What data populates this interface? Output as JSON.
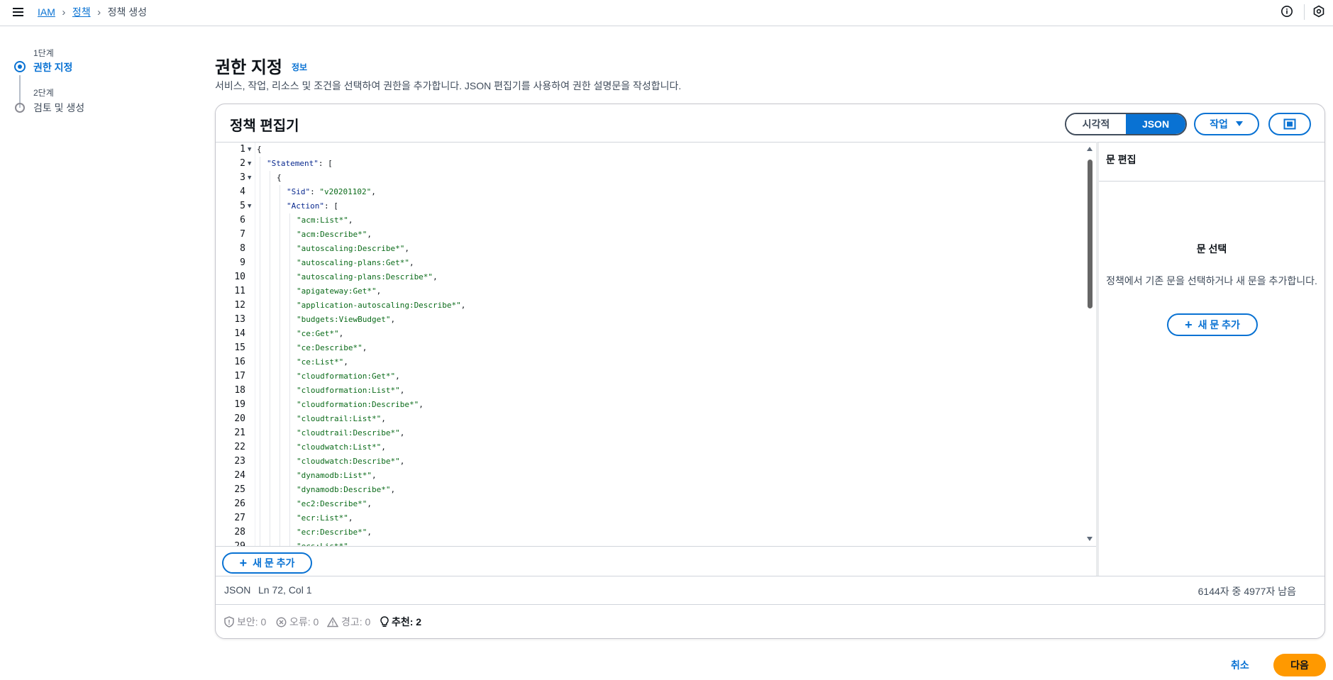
{
  "breadcrumb": {
    "iam": "IAM",
    "policies": "정책",
    "current": "정책 생성"
  },
  "steps": [
    {
      "number": "1단계",
      "title": "권한 지정"
    },
    {
      "number": "2단계",
      "title": "검토 및 생성"
    }
  ],
  "header": {
    "title": "권한 지정",
    "info": "정보",
    "description": "서비스, 작업, 리소스 및 조건을 선택하여 권한을 추가합니다. JSON 편집기를 사용하여 권한 설명문을 작성합니다."
  },
  "editor_panel": {
    "title": "정책 편집기",
    "mode_visual": "시각적",
    "mode_json": "JSON",
    "actions": "작업",
    "add_statement": "새 문 추가"
  },
  "code_lines": [
    {
      "n": "1",
      "fold": true,
      "indent": 0,
      "text": "{"
    },
    {
      "n": "2",
      "fold": true,
      "indent": 1,
      "key": "\"Statement\"",
      "text": ": ["
    },
    {
      "n": "3",
      "fold": true,
      "indent": 2,
      "text": "{"
    },
    {
      "n": "4",
      "fold": false,
      "indent": 3,
      "key": "\"Sid\"",
      "text": ": ",
      "str": "\"v20201102\"",
      "tail": ","
    },
    {
      "n": "5",
      "fold": true,
      "indent": 3,
      "key": "\"Action\"",
      "text": ": ["
    },
    {
      "n": "6",
      "fold": false,
      "indent": 4,
      "str": "\"acm:List*\"",
      "tail": ","
    },
    {
      "n": "7",
      "fold": false,
      "indent": 4,
      "str": "\"acm:Describe*\"",
      "tail": ","
    },
    {
      "n": "8",
      "fold": false,
      "indent": 4,
      "str": "\"autoscaling:Describe*\"",
      "tail": ","
    },
    {
      "n": "9",
      "fold": false,
      "indent": 4,
      "str": "\"autoscaling-plans:Get*\"",
      "tail": ","
    },
    {
      "n": "10",
      "fold": false,
      "indent": 4,
      "str": "\"autoscaling-plans:Describe*\"",
      "tail": ","
    },
    {
      "n": "11",
      "fold": false,
      "indent": 4,
      "str": "\"apigateway:Get*\"",
      "tail": ","
    },
    {
      "n": "12",
      "fold": false,
      "indent": 4,
      "str": "\"application-autoscaling:Describe*\"",
      "tail": ","
    },
    {
      "n": "13",
      "fold": false,
      "indent": 4,
      "str": "\"budgets:ViewBudget\"",
      "tail": ","
    },
    {
      "n": "14",
      "fold": false,
      "indent": 4,
      "str": "\"ce:Get*\"",
      "tail": ","
    },
    {
      "n": "15",
      "fold": false,
      "indent": 4,
      "str": "\"ce:Describe*\"",
      "tail": ","
    },
    {
      "n": "16",
      "fold": false,
      "indent": 4,
      "str": "\"ce:List*\"",
      "tail": ","
    },
    {
      "n": "17",
      "fold": false,
      "indent": 4,
      "str": "\"cloudformation:Get*\"",
      "tail": ","
    },
    {
      "n": "18",
      "fold": false,
      "indent": 4,
      "str": "\"cloudformation:List*\"",
      "tail": ","
    },
    {
      "n": "19",
      "fold": false,
      "indent": 4,
      "str": "\"cloudformation:Describe*\"",
      "tail": ","
    },
    {
      "n": "20",
      "fold": false,
      "indent": 4,
      "str": "\"cloudtrail:List*\"",
      "tail": ","
    },
    {
      "n": "21",
      "fold": false,
      "indent": 4,
      "str": "\"cloudtrail:Describe*\"",
      "tail": ","
    },
    {
      "n": "22",
      "fold": false,
      "indent": 4,
      "str": "\"cloudwatch:List*\"",
      "tail": ","
    },
    {
      "n": "23",
      "fold": false,
      "indent": 4,
      "str": "\"cloudwatch:Describe*\"",
      "tail": ","
    },
    {
      "n": "24",
      "fold": false,
      "indent": 4,
      "str": "\"dynamodb:List*\"",
      "tail": ","
    },
    {
      "n": "25",
      "fold": false,
      "indent": 4,
      "str": "\"dynamodb:Describe*\"",
      "tail": ","
    },
    {
      "n": "26",
      "fold": false,
      "indent": 4,
      "str": "\"ec2:Describe*\"",
      "tail": ","
    },
    {
      "n": "27",
      "fold": false,
      "indent": 4,
      "str": "\"ecr:List*\"",
      "tail": ","
    },
    {
      "n": "28",
      "fold": false,
      "indent": 4,
      "str": "\"ecr:Describe*\"",
      "tail": ","
    },
    {
      "n": "29",
      "fold": false,
      "indent": 4,
      "str": "\"ecs:List*\"",
      "tail": ","
    }
  ],
  "right_panel": {
    "title": "문 편집",
    "empty_title": "문 선택",
    "empty_desc": "정책에서 기존 문을 선택하거나 새 문을 추가합니다.",
    "add_statement": "새 문 추가"
  },
  "status": {
    "mode": "JSON",
    "position": "Ln 72, Col 1",
    "char_count": "6144자 중 4977자 남음"
  },
  "validation": {
    "security": "보안: 0",
    "errors": "오류: 0",
    "warnings": "경고: 0",
    "suggestions": "추천: 2"
  },
  "footer": {
    "cancel": "취소",
    "next": "다음"
  },
  "colors": {
    "accent": "#0972d3",
    "primary_button": "#ff9900",
    "text": "#0f141a",
    "string": "#0b6b1a",
    "key": "#0a2a8f"
  }
}
